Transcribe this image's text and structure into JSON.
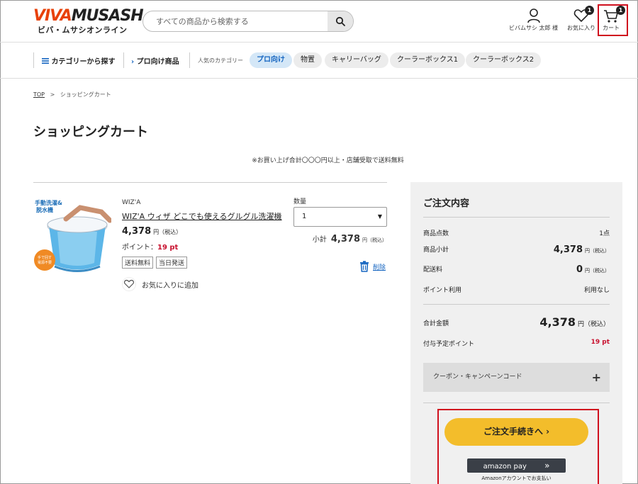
{
  "header": {
    "logo_main": "VIVAMUSASH",
    "logo_main_first": "VIVA",
    "logo_main_rest": "MUSASH",
    "logo_sub": "ビバ・ムサシオンライン",
    "search_placeholder": "すべての商品から検索する",
    "account_label": "ビバムサシ 太郎 様",
    "favorites_label": "お気に入り",
    "favorites_count": "1",
    "cart_label": "カート",
    "cart_count": "1"
  },
  "nav": {
    "category_button": "カテゴリーから探す",
    "pro_link": "プロ向け商品",
    "popular_label": "人気のカテゴリー",
    "chips": [
      "プロ向け",
      "物置",
      "キャリーバッグ",
      "クーラーボックス1",
      "クーラーボックス2"
    ],
    "active_chip": "プロ向け"
  },
  "breadcrumb": {
    "top": "TOP",
    "separator": ">",
    "current": "ショッピングカート"
  },
  "page": {
    "title": "ショッピングカート",
    "shipping_note": "※お買い上げ合計〇〇〇円以上・店舗受取で送料無料"
  },
  "cart_item": {
    "image_text_1": "手動洗濯&",
    "image_text_2": "脱水機",
    "image_badge_1": "手で回す",
    "image_badge_2": "電源不要",
    "brand": "WIZ'A",
    "name": "WIZ'A ウィザ どこでも使えるグルグル洗濯機",
    "price": "4,378",
    "price_unit": "円（税込）",
    "points_label": "ポイント：",
    "points_value": "19 pt",
    "tags": [
      "送料無料",
      "当日発送"
    ],
    "favorite_label": "お気に入りに追加",
    "qty_label": "数量",
    "qty_value": "1",
    "subtotal_label": "小計",
    "subtotal_value": "4,378",
    "subtotal_unit": "円（税込）",
    "delete_label": "削除"
  },
  "summary": {
    "title": "ご注文内容",
    "item_count_label": "商品点数",
    "item_count_value": "1点",
    "subtotal_label": "商品小計",
    "subtotal_value": "4,378",
    "subtotal_unit": "円（税込）",
    "shipping_label": "配送料",
    "shipping_value": "0",
    "shipping_unit": "円（税込）",
    "points_use_label": "ポイント利用",
    "points_use_value": "利用なし",
    "total_label": "合計金額",
    "total_value": "4,378",
    "total_unit": "円（税込）",
    "earn_points_label": "付与予定ポイント",
    "earn_points_value": "19 pt",
    "coupon_label": "クーポン・キャンペーンコード",
    "coupon_toggle": "+",
    "checkout_label": "ご注文手続きへ ›",
    "amazon_label": "amazon pay",
    "amazon_arrows": "»",
    "amazon_note": "Amazonアカウントでお支払い"
  },
  "colors": {
    "accent_red": "#c8102e",
    "checkout_yellow": "#f3bd2b",
    "link_blue": "#1565c0",
    "logo_orange": "#e8410a"
  }
}
